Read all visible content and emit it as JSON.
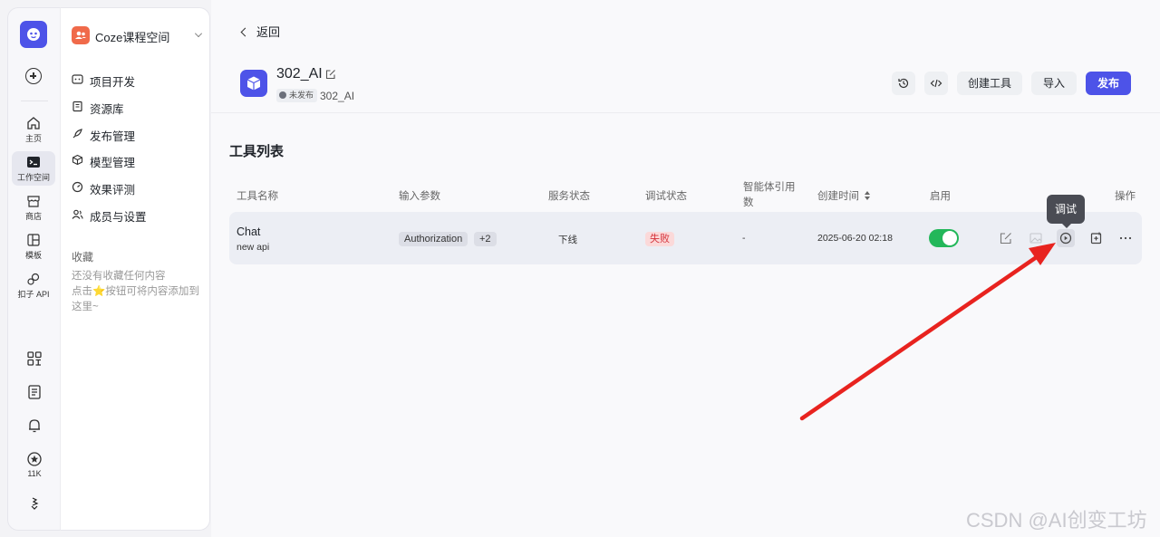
{
  "rail": {
    "items": [
      {
        "label": "主页",
        "icon": "home-icon"
      },
      {
        "label": "工作空间",
        "icon": "terminal-icon"
      },
      {
        "label": "商店",
        "icon": "store-icon"
      },
      {
        "label": "模板",
        "icon": "template-icon"
      },
      {
        "label": "扣子 API",
        "icon": "api-icon"
      }
    ],
    "star_count": "11K"
  },
  "sidebar": {
    "workspace": "Coze课程空间",
    "menu": [
      {
        "label": "项目开发",
        "icon": "project-icon"
      },
      {
        "label": "资源库",
        "icon": "library-icon"
      },
      {
        "label": "发布管理",
        "icon": "rocket-icon"
      },
      {
        "label": "模型管理",
        "icon": "cube-icon"
      },
      {
        "label": "效果评测",
        "icon": "gauge-icon"
      },
      {
        "label": "成员与设置",
        "icon": "members-icon"
      }
    ],
    "favorites_title": "收藏",
    "favorites_empty_1": "还没有收藏任何内容",
    "favorites_empty_2": "点击⭐按钮可将内容添加到这里~"
  },
  "header": {
    "back_label": "返回",
    "plugin_name": "302_AI",
    "status_badge": "未发布",
    "plugin_subtitle": "302_AI",
    "create_tool_label": "创建工具",
    "import_label": "导入",
    "publish_label": "发布"
  },
  "tool_list": {
    "title": "工具列表",
    "columns": [
      "工具名称",
      "输入参数",
      "服务状态",
      "调试状态",
      "智能体引用数",
      "创建时间",
      "启用",
      "操作"
    ],
    "rows": [
      {
        "name": "Chat",
        "description": "new api",
        "param_tag": "Authorization",
        "param_more": "+2",
        "service_status": "下线",
        "debug_status": "失败",
        "agent_refs": "-",
        "created_at": "2025-06-20 02:18",
        "enabled": true
      }
    ]
  },
  "tooltip": "调试",
  "watermark": "CSDN @AI创变工坊",
  "colors": {
    "accent": "#4d53e8",
    "success": "#23b75a",
    "danger": "#d5333b",
    "annotation_arrow": "#e8231f"
  }
}
